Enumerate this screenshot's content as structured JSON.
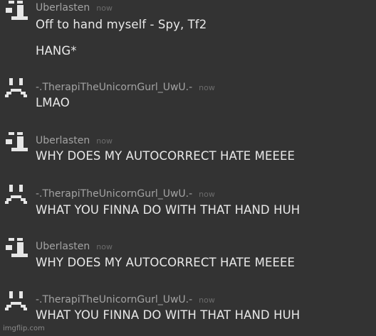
{
  "messages": [
    {
      "author": "Uberlasten",
      "avatar": "robot-avatar-icon",
      "time": "now",
      "lines": [
        "Off to hand myself - Spy, Tf2",
        "HANG*"
      ]
    },
    {
      "author": "-.TherapiTheUnicornGurl_UwU.-",
      "avatar": "sad-face-avatar-icon",
      "time": "now",
      "lines": [
        "LMAO"
      ]
    },
    {
      "author": "Uberlasten",
      "avatar": "robot-avatar-icon",
      "time": "now",
      "lines": [
        "WHY DOES MY AUTOCORRECT HATE MEEEE"
      ]
    },
    {
      "author": "-.TherapiTheUnicornGurl_UwU.-",
      "avatar": "sad-face-avatar-icon",
      "time": "now",
      "lines": [
        "WHAT YOU FINNA DO WITH THAT HAND HUH"
      ]
    },
    {
      "author": "Uberlasten",
      "avatar": "robot-avatar-icon",
      "time": "now",
      "lines": [
        "WHY DOES MY AUTOCORRECT HATE MEEEE"
      ]
    },
    {
      "author": "-.TherapiTheUnicornGurl_UwU.-",
      "avatar": "sad-face-avatar-icon",
      "time": "now",
      "lines": [
        "WHAT YOU FINNA DO WITH THAT HAND HUH"
      ]
    }
  ],
  "watermark": "imgflip.com",
  "colors": {
    "background": "#333333",
    "author": "#a3a3a3",
    "timestamp": "#6c6c6c",
    "message": "#e9e9e9"
  }
}
